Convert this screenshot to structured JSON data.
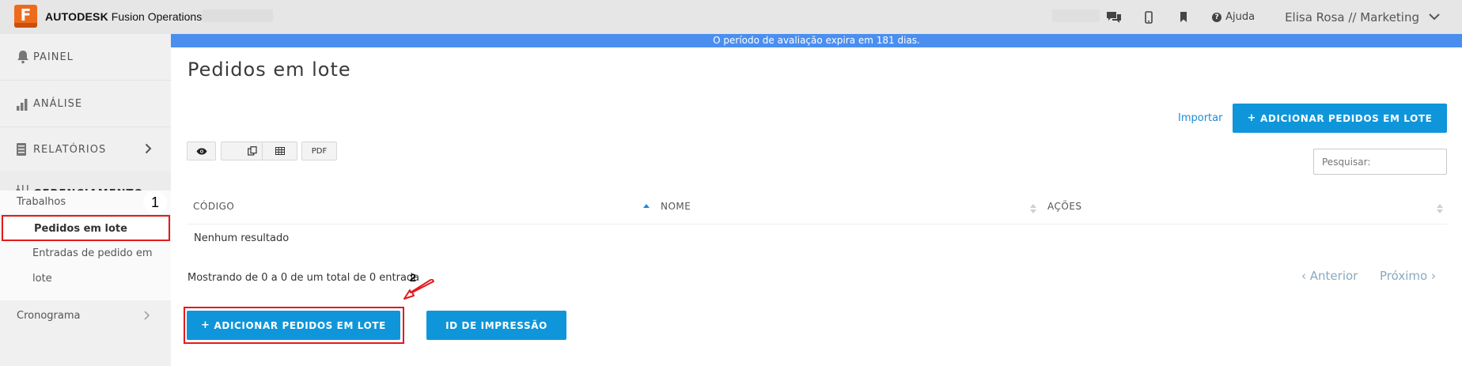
{
  "app": {
    "brand_letter": "F",
    "brand_bold": "AUTODESK",
    "brand_name": "Fusion Operations"
  },
  "topbar": {
    "icons": [
      "chat-icon",
      "mobile-icon",
      "bookmark-icon",
      "help-icon"
    ],
    "help_label": "Ajuda",
    "user_label": "Elisa Rosa // Marketing"
  },
  "banner": {
    "text": "O período de avaliação expira em 181 dias."
  },
  "sidebar": {
    "items": [
      {
        "label": "PAINEL",
        "icon": "bell-icon"
      },
      {
        "label": "ANÁLISE",
        "icon": "bar-chart-icon"
      },
      {
        "label": "RELATÓRIOS",
        "icon": "report-icon"
      },
      {
        "label": "GERENCIAMENTO",
        "icon": "sliders-icon"
      }
    ],
    "sub": {
      "trabalhos": "Trabalhos",
      "pedidos": "Pedidos em lote",
      "entradas_1": "Entradas de pedido em",
      "entradas_2": "lote",
      "cronograma": "Cronograma"
    },
    "step_marker": "1"
  },
  "main": {
    "title": "Pedidos em lote",
    "import_link": "Importar",
    "add_top_button": "ADICIONAR PEDIDOS EM LOTE",
    "toolbar": {
      "icons": [
        "eye-icon",
        "copy-icon",
        "table-icon"
      ],
      "pdf_label": "PDF"
    },
    "search": {
      "placeholder": "Pesquisar:"
    },
    "table": {
      "columns": [
        "CÓDIGO",
        "NOME",
        "AÇÕES"
      ],
      "empty_text": "Nenhum resultado"
    },
    "showing_text": "Mostrando de 0 a 0 de um total de 0 entrada",
    "step_marker": "2",
    "pager": {
      "prev": "Anterior",
      "next": "Próximo"
    },
    "add_bottom_button": "ADICIONAR PEDIDOS EM LOTE",
    "print_button": "ID DE IMPRESSÃO"
  },
  "colors": {
    "accent": "#0f96da",
    "banner": "#4a8ff0",
    "highlight": "#e21b1b",
    "brand": "#ee6b1d"
  }
}
